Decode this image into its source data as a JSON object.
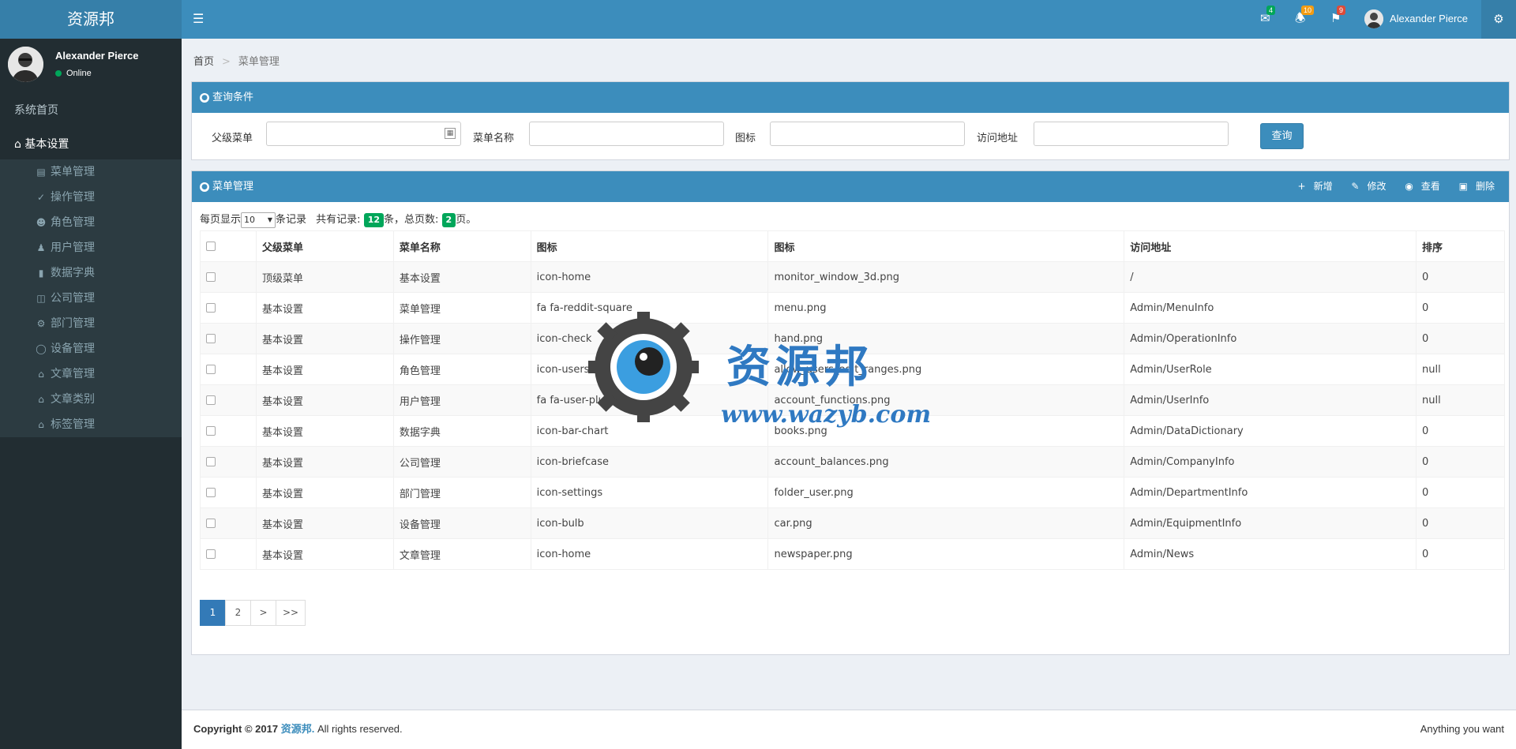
{
  "app": {
    "logo": "资源邦"
  },
  "topbar": {
    "messages_count": "4",
    "notifications_count": "10",
    "tasks_count": "9",
    "user_name": "Alexander Pierce",
    "colors": {
      "bar": "#3c8dbc",
      "badge_green": "#00a65a",
      "badge_yellow": "#f39c12",
      "badge_red": "#dd4b39"
    }
  },
  "sidebar": {
    "user_name": "Alexander Pierce",
    "status": "Online",
    "home": "系统首页",
    "basic_settings": "基本设置",
    "items": [
      {
        "label": "菜单管理",
        "icon": "list-icon"
      },
      {
        "label": "操作管理",
        "icon": "check-circle-icon"
      },
      {
        "label": "角色管理",
        "icon": "users-icon"
      },
      {
        "label": "用户管理",
        "icon": "user-plus-icon"
      },
      {
        "label": "数据字典",
        "icon": "bar-chart-icon"
      },
      {
        "label": "公司管理",
        "icon": "briefcase-icon"
      },
      {
        "label": "部门管理",
        "icon": "settings-icon"
      },
      {
        "label": "设备管理",
        "icon": "bulb-icon"
      },
      {
        "label": "文章管理",
        "icon": "home-icon"
      },
      {
        "label": "文章类别",
        "icon": "home-icon"
      },
      {
        "label": "标签管理",
        "icon": "home-icon"
      }
    ]
  },
  "breadcrumb": {
    "home": "首页",
    "sep": ">",
    "current": "菜单管理"
  },
  "query": {
    "title": "查询条件",
    "parent_label": "父级菜单",
    "name_label": "菜单名称",
    "icon_label": "图标",
    "url_label": "访问地址",
    "button": "查询"
  },
  "list": {
    "title": "菜单管理",
    "add": "新增",
    "edit": "修改",
    "view": "查看",
    "delete": "删除",
    "per_page_prefix": "每页显示",
    "per_page_value": "10",
    "per_page_suffix": "条记录",
    "total_prefix": "共有记录:",
    "total": "12",
    "total_suffix": "条，总页数:",
    "pages": "2",
    "pages_suffix": "页。",
    "headers": [
      "父级菜单",
      "菜单名称",
      "图标",
      "图标",
      "访问地址",
      "排序"
    ],
    "rows": [
      [
        "顶级菜单",
        "基本设置",
        "icon-home",
        "monitor_window_3d.png",
        "/",
        "0"
      ],
      [
        "基本设置",
        "菜单管理",
        "fa fa-reddit-square",
        "menu.png",
        "Admin/MenuInfo",
        "0"
      ],
      [
        "基本设置",
        "操作管理",
        "icon-check",
        "hand.png",
        "Admin/OperationInfo",
        "0"
      ],
      [
        "基本设置",
        "角色管理",
        "icon-users",
        "allow_users_edit_ranges.png",
        "Admin/UserRole",
        "null"
      ],
      [
        "基本设置",
        "用户管理",
        "fa fa-user-plus",
        "account_functions.png",
        "Admin/UserInfo",
        "null"
      ],
      [
        "基本设置",
        "数据字典",
        "icon-bar-chart",
        "books.png",
        "Admin/DataDictionary",
        "0"
      ],
      [
        "基本设置",
        "公司管理",
        "icon-briefcase",
        "account_balances.png",
        "Admin/CompanyInfo",
        "0"
      ],
      [
        "基本设置",
        "部门管理",
        "icon-settings",
        "folder_user.png",
        "Admin/DepartmentInfo",
        "0"
      ],
      [
        "基本设置",
        "设备管理",
        "icon-bulb",
        "car.png",
        "Admin/EquipmentInfo",
        "0"
      ],
      [
        "基本设置",
        "文章管理",
        "icon-home",
        "newspaper.png",
        "Admin/News",
        "0"
      ]
    ],
    "pagination": [
      "1",
      "2",
      ">",
      ">>"
    ]
  },
  "footer": {
    "copyright": "Copyright © 2017",
    "brand": "资源邦.",
    "rights": "All rights reserved.",
    "right": "Anything you want"
  },
  "watermark": {
    "text": "资源邦",
    "url": "www.wazyb.com"
  }
}
